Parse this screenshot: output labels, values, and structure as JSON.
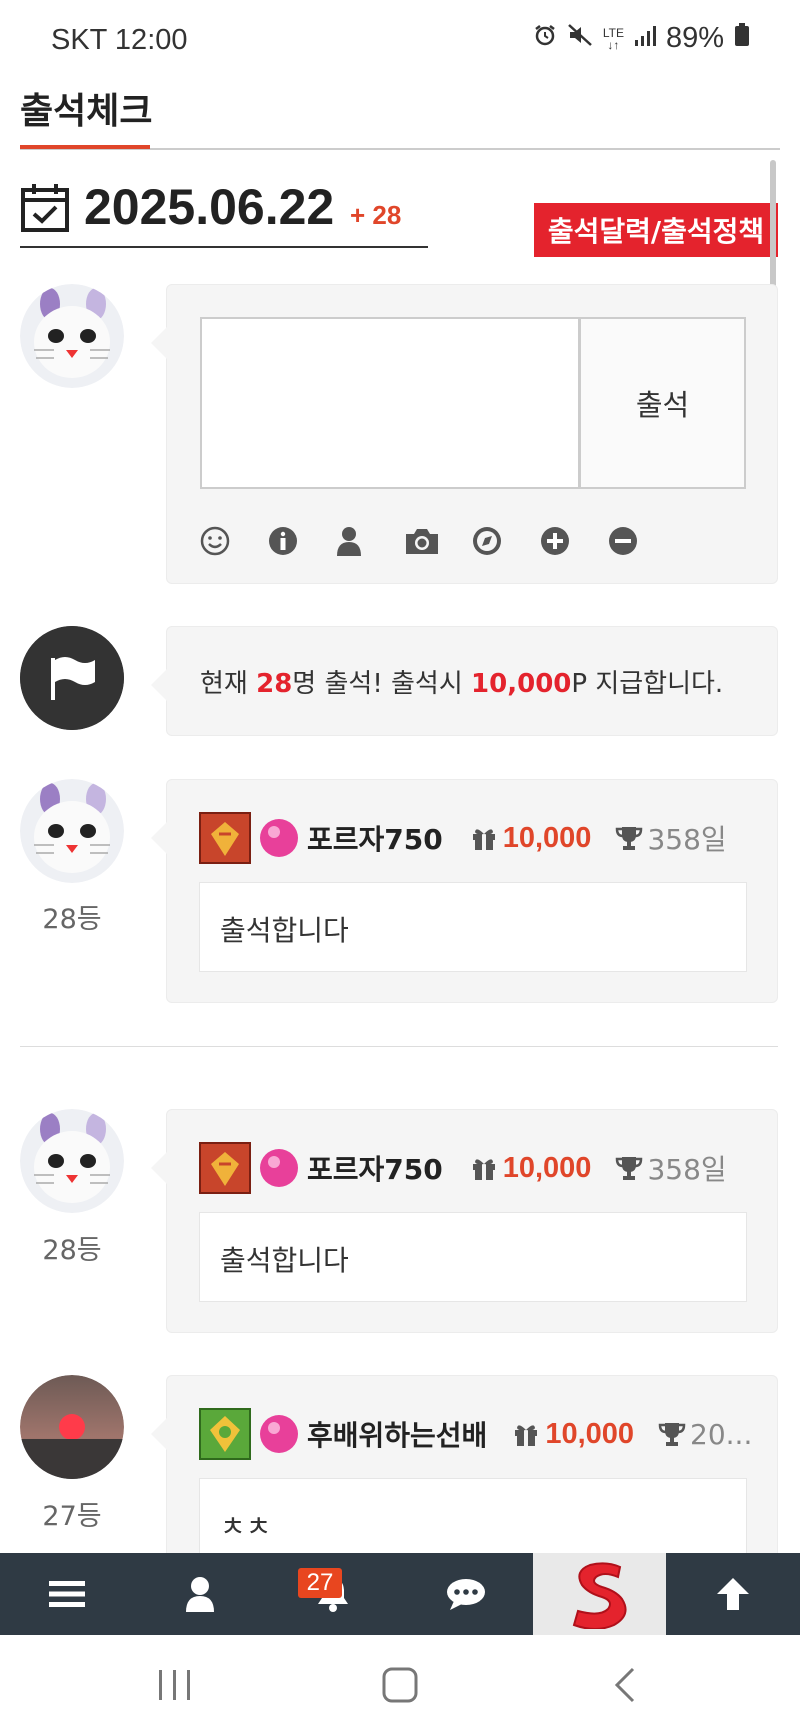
{
  "status_bar": {
    "carrier_time": "SKT 12:00",
    "network": "LTE",
    "battery": "89%"
  },
  "page": {
    "title": "출석체크",
    "date": "2025.06.22",
    "date_count": "+ 28",
    "policy_button": "출석달력/출석정책"
  },
  "write_box": {
    "submit_label": "출석",
    "tools": [
      "smile-icon",
      "info-icon",
      "user-icon",
      "camera-icon",
      "compass-icon",
      "plus-icon",
      "minus-icon"
    ]
  },
  "notice": {
    "prefix": "현재 ",
    "count": "28",
    "mid": "명 출석! 출석시 ",
    "points": "10,000",
    "suffix": "P 지급합니다."
  },
  "entries": [
    {
      "rank": "28등",
      "username": "포르자750",
      "points": "10,000",
      "days": "358일",
      "message": "출석합니다"
    },
    {
      "rank": "28등",
      "username": "포르자750",
      "points": "10,000",
      "days": "358일",
      "message": "출석합니다"
    },
    {
      "rank": "27등",
      "username": "후배위하는선배",
      "points": "10,000",
      "days": "20...",
      "message": "ㅊㅊ"
    }
  ],
  "bottom_nav": {
    "notification_count": "27",
    "items": [
      "menu-icon",
      "user-icon",
      "bell-icon",
      "chat-icon",
      "site-logo",
      "arrow-up-icon"
    ]
  },
  "colors": {
    "accent_red": "#e4232d",
    "points_orange": "#e0462a",
    "nav_bg": "#2f3a44"
  }
}
